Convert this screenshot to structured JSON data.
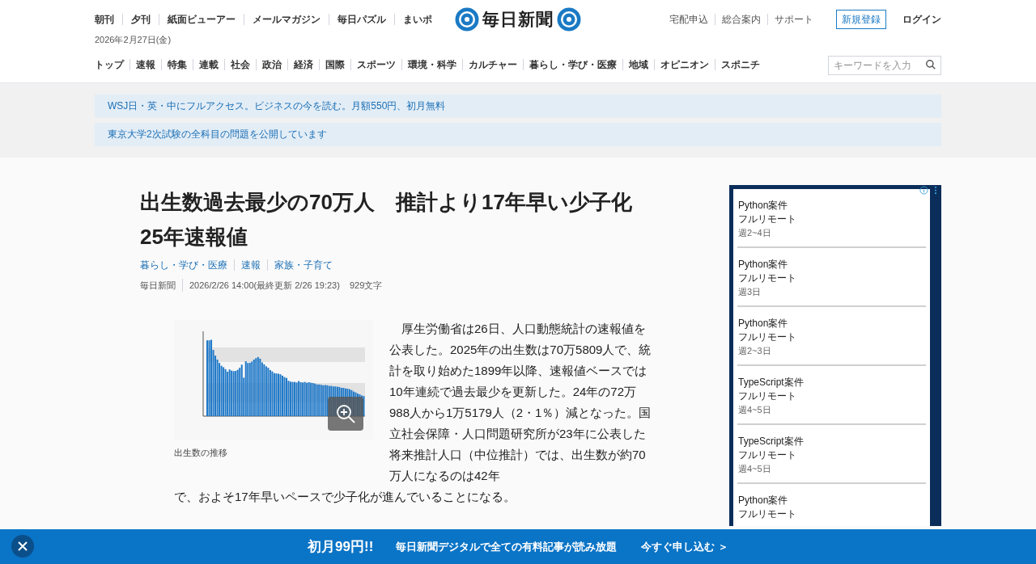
{
  "header": {
    "top_links": [
      "朝刊",
      "夕刊",
      "紙面ビューアー",
      "メールマガジン",
      "毎日パズル",
      "まいポ"
    ],
    "logo": "毎日新聞",
    "service_links": [
      "宅配申込",
      "総合案内",
      "サポート"
    ],
    "register": "新規登録",
    "login": "ログイン",
    "date": "2026年2月27日(金)"
  },
  "nav": {
    "items": [
      "トップ",
      "速報",
      "特集",
      "連載",
      "社会",
      "政治",
      "経済",
      "国際",
      "スポーツ",
      "環境・科学",
      "カルチャー",
      "暮らし・学び・医療",
      "地域",
      "オピニオン",
      "スポニチ"
    ],
    "search_placeholder": "キーワードを入力"
  },
  "promos": [
    "WSJ日・英・中にフルアクセス。ビジネスの今を読む。月額550円、初月無料",
    "東京大学2次試験の全科目の問題を公開しています"
  ],
  "article": {
    "title": "出生数過去最少の70万人　推計より17年早い少子化　25年速報値",
    "tags": [
      "暮らし・学び・医療",
      "速報",
      "家族・子育て"
    ],
    "source": "毎日新聞",
    "timestamp": "2026/2/26 14:00(最終更新 2/26 19:23)",
    "length": "929文字",
    "figure_caption": "出生数の推移",
    "body": [
      "　厚生労働省は26日、人口動態統計の速報値を公表した。2025年の出生数は70万5809人で、統計を取り始めた1899年以降、速報値ベースでは10年連続で過去最少を更新した。24年の72万988人から1万5179人（2・1％）減となった。国立社会保障・人口問題研究所が23年に公表した将来推計人口（中位推計）では、出生数が約70万人になるのは42年",
      "で、およそ17年早いペースで少子化が進んでいることになる。"
    ]
  },
  "ad": {
    "items": [
      {
        "title": "Python案件",
        "subtitle": "フルリモート",
        "days": "週2~4日"
      },
      {
        "title": "Python案件",
        "subtitle": "フルリモート",
        "days": "週3日"
      },
      {
        "title": "Python案件",
        "subtitle": "フルリモート",
        "days": "週2~3日"
      },
      {
        "title": "TypeScript案件",
        "subtitle": "フルリモート",
        "days": "週4~5日"
      },
      {
        "title": "TypeScript案件",
        "subtitle": "フルリモート",
        "days": "週4~5日"
      },
      {
        "title": "Python案件",
        "subtitle": "フルリモート"
      }
    ]
  },
  "banner": {
    "price": "初月99円!!",
    "message": "毎日新聞デジタルで全ての有料記事が読み放題",
    "cta": "今すぐ申し込む ＞"
  }
}
